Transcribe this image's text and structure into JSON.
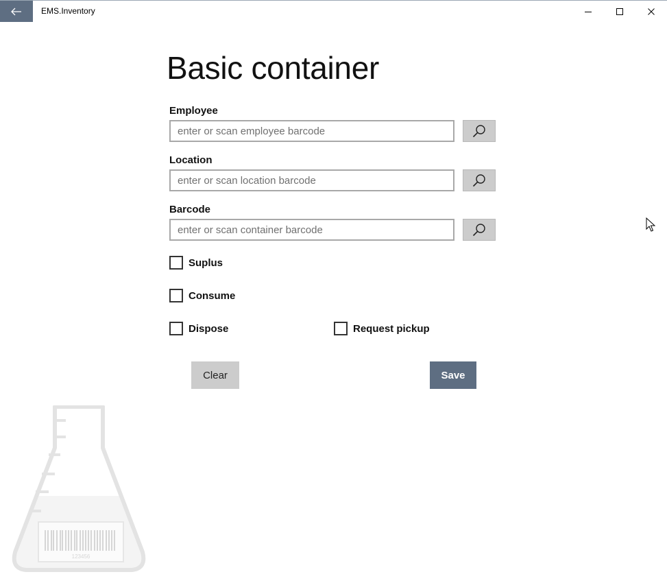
{
  "titlebar": {
    "app_title": "EMS.Inventory",
    "back_icon": "arrow-left-icon",
    "minimize_icon": "minimize-icon",
    "maximize_icon": "maximize-icon",
    "close_icon": "close-icon"
  },
  "page": {
    "title": "Basic container"
  },
  "form": {
    "employee": {
      "label": "Employee",
      "value": "",
      "placeholder": "enter or scan employee barcode"
    },
    "location": {
      "label": "Location",
      "value": "",
      "placeholder": "enter or scan location barcode"
    },
    "barcode": {
      "label": "Barcode",
      "value": "",
      "placeholder": "enter or scan container barcode"
    },
    "checkboxes": {
      "suplus": {
        "label": "Suplus",
        "checked": false
      },
      "consume": {
        "label": "Consume",
        "checked": false
      },
      "dispose": {
        "label": "Dispose",
        "checked": false
      },
      "request_pickup": {
        "label": "Request pickup",
        "checked": false
      }
    }
  },
  "actions": {
    "clear_label": "Clear",
    "save_label": "Save"
  },
  "colors": {
    "accent": "#5e6e82",
    "button_gray": "#cccccc",
    "input_border": "#a8a8a8"
  },
  "decoration": {
    "flask_barcode_number": "123456"
  }
}
